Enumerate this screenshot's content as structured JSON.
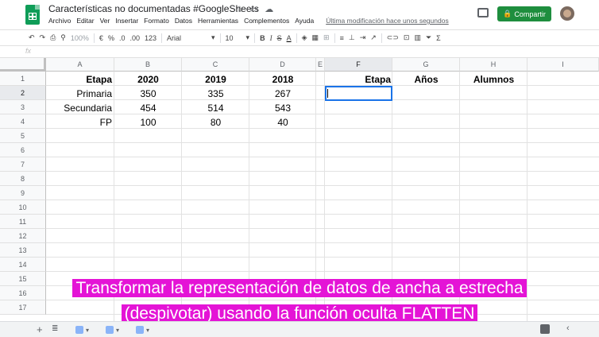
{
  "header": {
    "title": "Características no documentadas #GoogleSheets",
    "menu": [
      "Archivo",
      "Editar",
      "Ver",
      "Insertar",
      "Formato",
      "Datos",
      "Herramientas",
      "Complementos",
      "Ayuda"
    ],
    "last_edit": "Última modificación hace unos segundos",
    "share_label": "Compartir"
  },
  "toolbar": {
    "zoom": "100%",
    "currency": "€",
    "percent": "%",
    "dec_less": ".0",
    "dec_more": ".00",
    "format_more": "123",
    "font": "Arial",
    "font_size": "10",
    "bold": "B",
    "italic": "I",
    "strike": "S",
    "text_color": "A"
  },
  "formula_bar": {
    "fx": "fx",
    "value": ""
  },
  "columns": [
    "A",
    "B",
    "C",
    "D",
    "E",
    "F",
    "G",
    "H",
    "I"
  ],
  "rows": [
    "1",
    "2",
    "3",
    "4",
    "5",
    "6",
    "7",
    "8",
    "9",
    "10",
    "11",
    "12",
    "13",
    "14",
    "15",
    "16",
    "17"
  ],
  "cells": {
    "A1": "Etapa",
    "B1": "2020",
    "C1": "2019",
    "D1": "2018",
    "A2": "Primaria",
    "B2": "350",
    "C2": "335",
    "D2": "267",
    "A3": "Secundaria",
    "B3": "454",
    "C3": "514",
    "D3": "543",
    "A4": "FP",
    "B4": "100",
    "C4": "80",
    "D4": "40",
    "F1": "Etapa",
    "G1": "Años",
    "H1": "Alumnos"
  },
  "caption": {
    "line1": "Transformar la representación de datos de ancha a estrecha",
    "line2": "(despivotar) usando la función oculta FLATTEN"
  },
  "colors": {
    "share_green": "#1e8e3e",
    "selection_blue": "#1a73e8",
    "caption_magenta": "#e414d6",
    "sheets_green": "#0f9d58"
  }
}
